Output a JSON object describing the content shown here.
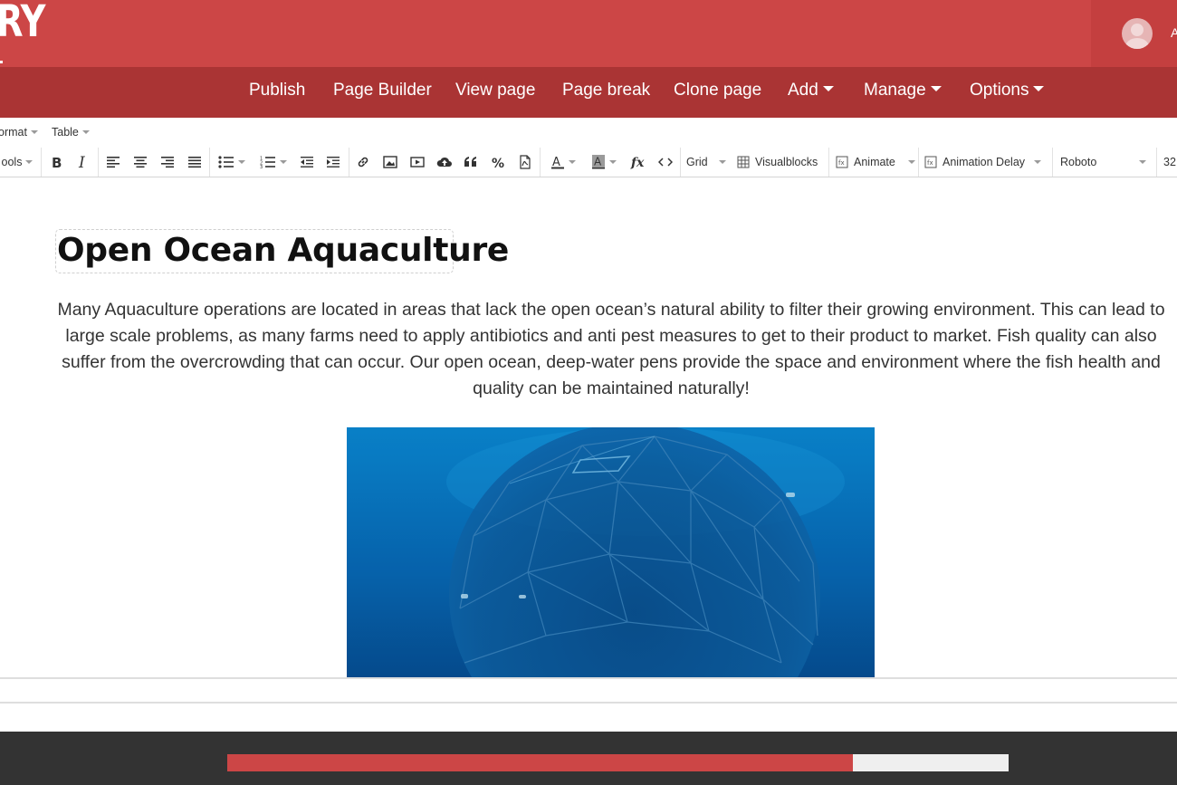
{
  "header": {
    "logo_text": "RY",
    "user_initial": "A"
  },
  "nav": {
    "items": [
      {
        "label": "Publish"
      },
      {
        "label": "Page Builder"
      },
      {
        "label": "View page"
      },
      {
        "label": "Page break"
      },
      {
        "label": "Clone page"
      },
      {
        "label": "Add",
        "dropdown": true
      },
      {
        "label": "Manage",
        "dropdown": true
      },
      {
        "label": "Options",
        "dropdown": true
      }
    ]
  },
  "editor": {
    "menubar": {
      "format": "ormat",
      "table": "Table"
    },
    "toolbar": {
      "tools": "ools",
      "grid": "Grid",
      "visualblocks": "Visualblocks",
      "animate": "Animate",
      "animation_delay": "Animation Delay",
      "font_family": "Roboto",
      "font_size": "32"
    }
  },
  "content": {
    "heading": "Open Ocean Aquaculture",
    "paragraph": "Many Aquaculture operations are located in areas that lack the open ocean’s natural ability to filter their growing environment. This can lead to large scale problems, as many farms need to apply antibiotics and anti pest measures to get to their product to market.  Fish quality can also suffer from the overcrowding that can occur. Our open ocean, deep-water pens provide the space and environment where the fish health and quality can be maintained naturally!"
  },
  "footer": {
    "progress": 0.801
  },
  "colors": {
    "header_red": "#cc4646",
    "nav_red": "#aa3434",
    "footer_dark": "#333333"
  }
}
